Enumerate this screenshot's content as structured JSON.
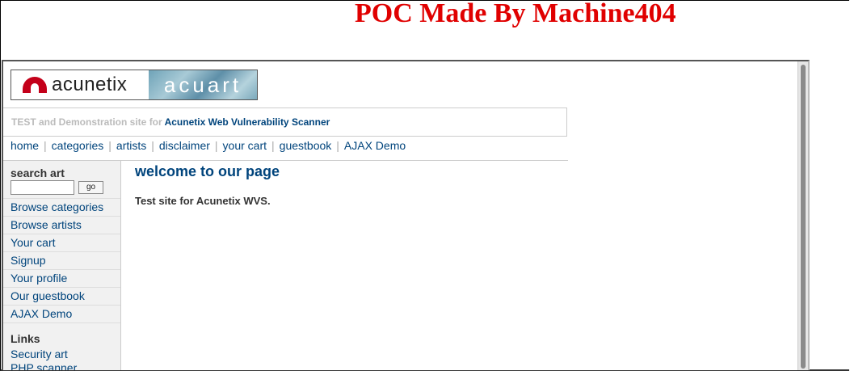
{
  "poc_title": "POC Made By Machine404",
  "logo": {
    "brand": "acunetix",
    "product": "acuart"
  },
  "tagline": {
    "prefix": "TEST and Demonstration site for ",
    "link": "Acunetix Web Vulnerability Scanner"
  },
  "topnav": [
    "home",
    "categories",
    "artists",
    "disclaimer",
    "your cart",
    "guestbook",
    "AJAX Demo"
  ],
  "sidebar": {
    "search_title": "search art",
    "search_value": "",
    "go_label": "go",
    "menu": [
      "Browse categories",
      "Browse artists",
      "Your cart",
      "Signup",
      "Your profile",
      "Our guestbook",
      "AJAX Demo"
    ],
    "links_title": "Links",
    "links": [
      "Security art",
      "PHP scanner"
    ]
  },
  "main": {
    "heading": "welcome to our page",
    "text": "Test site for Acunetix WVS."
  },
  "colors": {
    "poc_red": "#e00000",
    "link_blue": "#00447c"
  }
}
